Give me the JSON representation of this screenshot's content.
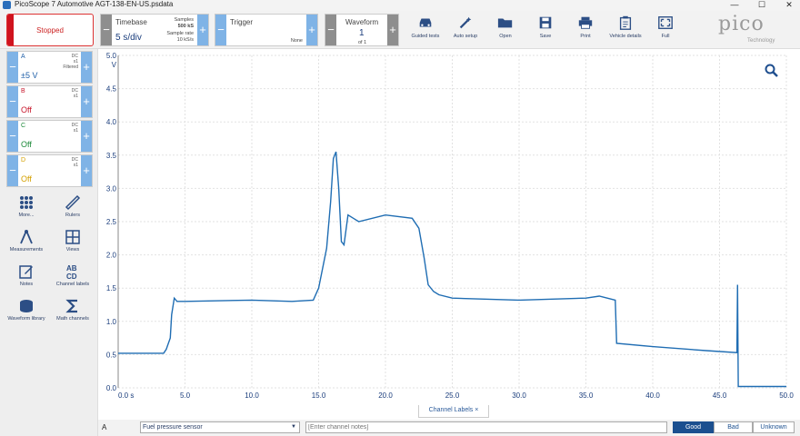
{
  "window": {
    "title": "PicoScope 7 Automotive AGT-138-EN-US.psdata"
  },
  "toolbar": {
    "run_state": "Stopped",
    "timebase": {
      "label": "Timebase",
      "value": "5 s/div",
      "samples_label": "Samples",
      "samples_value": "500 kS",
      "rate_label": "Sample rate",
      "rate_value": "10 kS/s"
    },
    "trigger": {
      "label": "Trigger",
      "mode": "None"
    },
    "waveform": {
      "label": "Waveform",
      "index": "1",
      "of": "of 1"
    },
    "buttons": [
      "Guided tests",
      "Auto setup",
      "Open",
      "Save",
      "Print",
      "Vehicle details",
      "Full"
    ],
    "logo": "pico",
    "logo_sub": "Technology"
  },
  "channels": [
    {
      "name": "A",
      "coupling": "DC",
      "probe": "x1",
      "filter": "Filtered",
      "range": "±5 V",
      "color": "#1f5fa8"
    },
    {
      "name": "B",
      "coupling": "DC",
      "probe": "x1",
      "filter": "",
      "range": "Off",
      "color": "#c7162b"
    },
    {
      "name": "C",
      "coupling": "DC",
      "probe": "x1",
      "filter": "",
      "range": "Off",
      "color": "#1d8a3a"
    },
    {
      "name": "D",
      "coupling": "DC",
      "probe": "x1",
      "filter": "",
      "range": "Off",
      "color": "#d4a000"
    }
  ],
  "tools": [
    "More...",
    "Rulers",
    "Measurements",
    "Views",
    "Notes",
    "Channel labels",
    "Waveform library",
    "Math channels"
  ],
  "chart_data": {
    "type": "line",
    "xlabel": "",
    "ylabel": "V",
    "xlim": [
      0,
      50
    ],
    "ylim": [
      0,
      5
    ],
    "x_ticks": [
      "0.0 s",
      "5.0",
      "10.0",
      "15.0",
      "20.0",
      "25.0",
      "30.0",
      "35.0",
      "40.0",
      "45.0",
      "50.0"
    ],
    "y_ticks": [
      "0.0",
      "0.5",
      "1.0",
      "1.5",
      "2.0",
      "2.5",
      "3.0",
      "3.5",
      "4.0",
      "4.5",
      "5.0"
    ],
    "grid": true,
    "series": [
      {
        "color": "#1f6db3",
        "x": [
          0,
          3.4,
          3.6,
          3.9,
          4.0,
          4.2,
          4.4,
          5,
          10,
          13,
          14.6,
          15,
          15.3,
          15.6,
          15.9,
          16.1,
          16.3,
          16.5,
          16.7,
          16.9,
          17.2,
          17.6,
          18,
          20,
          22,
          22.5,
          22.9,
          23.2,
          23.6,
          24,
          25,
          30,
          35,
          36,
          37.2,
          37.3,
          40,
          44,
          46.3,
          46.35,
          46.4,
          50
        ],
        "y": [
          0.52,
          0.52,
          0.58,
          0.75,
          1.1,
          1.35,
          1.3,
          1.3,
          1.32,
          1.3,
          1.32,
          1.5,
          1.8,
          2.1,
          2.8,
          3.45,
          3.55,
          3.0,
          2.2,
          2.15,
          2.6,
          2.55,
          2.5,
          2.6,
          2.55,
          2.4,
          1.95,
          1.55,
          1.45,
          1.4,
          1.35,
          1.32,
          1.35,
          1.38,
          1.32,
          0.67,
          0.62,
          0.56,
          0.53,
          1.55,
          0.02,
          0.02
        ]
      }
    ]
  },
  "bottom": {
    "channel_labels_tab": "Channel Labels ×",
    "channel": "A",
    "label_select": "Fuel pressure sensor",
    "notes_placeholder": "[Enter channel notes]",
    "ratings": [
      "Good",
      "Bad",
      "Unknown"
    ]
  }
}
